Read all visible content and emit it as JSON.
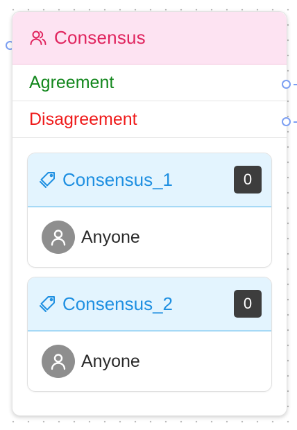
{
  "node": {
    "title": "Consensus",
    "icon": "users-icon",
    "header_color": "#fde3f2",
    "title_color": "#e0245e"
  },
  "outcomes": [
    {
      "label": "Agreement",
      "color": "#13871d"
    },
    {
      "label": "Disagreement",
      "color": "#ef1b1b"
    }
  ],
  "cards": [
    {
      "title": "Consensus_1",
      "icon": "tag-icon",
      "count": "0",
      "assignee": "Anyone",
      "assignee_icon": "user-icon"
    },
    {
      "title": "Consensus_2",
      "icon": "tag-icon",
      "count": "0",
      "assignee": "Anyone",
      "assignee_icon": "user-icon"
    }
  ],
  "colors": {
    "handle": "#7c9ff2",
    "card_header": "#e3f4fe",
    "card_title": "#1e8fe1",
    "badge": "#3d3d3d"
  }
}
